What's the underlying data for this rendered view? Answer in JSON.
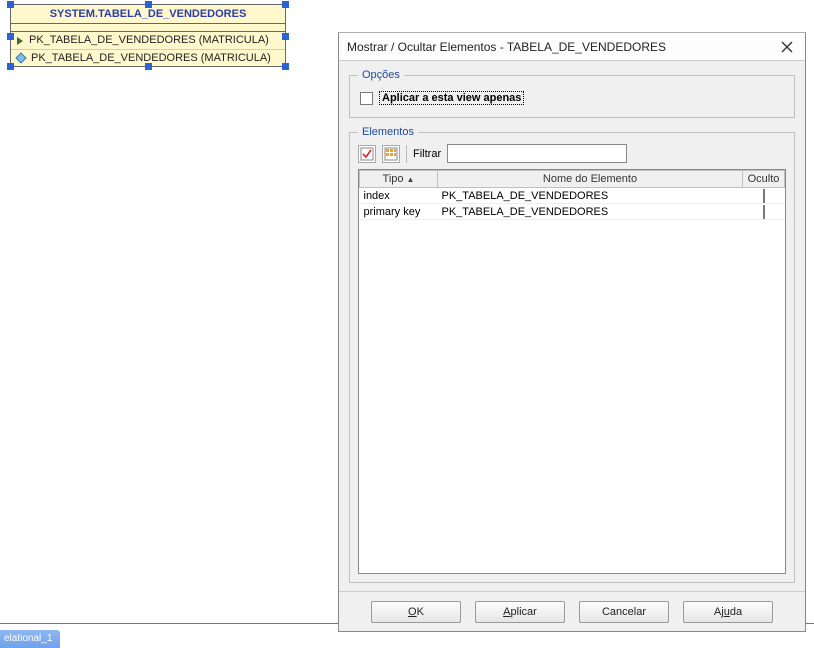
{
  "entity": {
    "title": "SYSTEM.TABELA_DE_VENDEDORES",
    "rows": [
      "PK_TABELA_DE_VENDEDORES (MATRICULA)",
      "PK_TABELA_DE_VENDEDORES (MATRICULA)"
    ]
  },
  "status_tab": "elational_1",
  "dialog": {
    "title": "Mostrar / Ocultar Elementos - TABELA_DE_VENDEDORES",
    "groups": {
      "options_legend": "Opções",
      "elements_legend": "Elementos"
    },
    "options": {
      "apply_view_only": "Aplicar a esta view apenas"
    },
    "filter_label": "Filtrar",
    "table": {
      "headers": {
        "type": "Tipo",
        "element_name": "Nome do Elemento",
        "hidden": "Oculto"
      },
      "rows": [
        {
          "type": "index",
          "name": "PK_TABELA_DE_VENDEDORES",
          "hidden": false
        },
        {
          "type": "primary key",
          "name": "PK_TABELA_DE_VENDEDORES",
          "hidden": false
        }
      ]
    },
    "buttons": {
      "ok": "OK",
      "apply": "Aplicar",
      "cancel": "Cancelar",
      "help": "Ajuda"
    }
  }
}
